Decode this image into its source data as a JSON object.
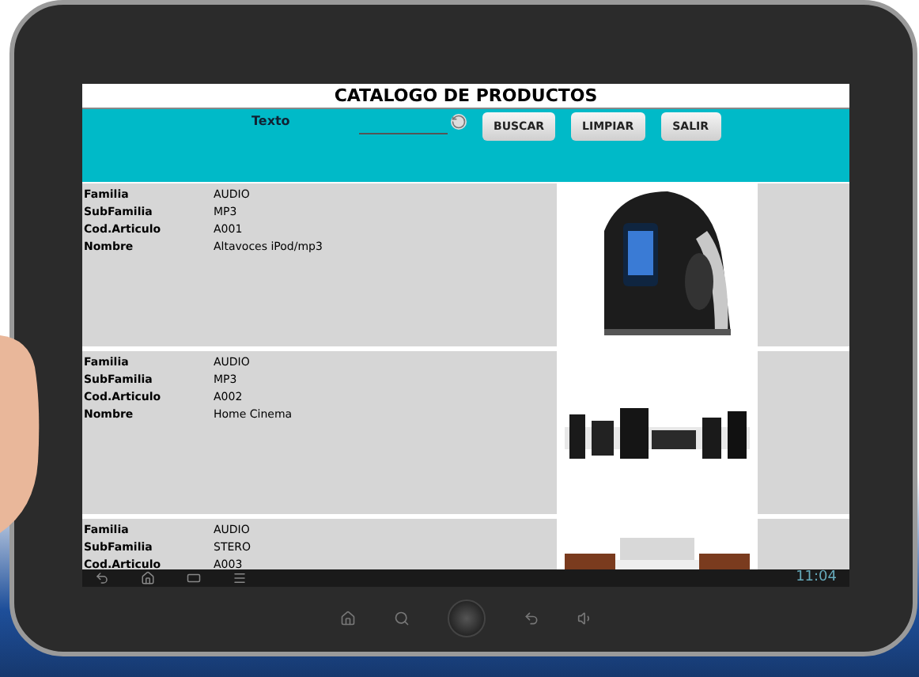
{
  "title": "CATALOGO DE PRODUCTOS",
  "search": {
    "label": "Texto"
  },
  "buttons": [
    "BUSCAR",
    "LIMPIAR",
    "SALIR"
  ],
  "products": [
    {
      "fields": [
        {
          "label": "Familia",
          "value": "AUDIO"
        },
        {
          "label": "SubFamilia",
          "value": "MP3"
        },
        {
          "label": "Cod.Articulo",
          "value": "A001"
        },
        {
          "label": "Nombre",
          "value": "Altavoces iPod/mp3"
        }
      ],
      "picture": {
        "kind": "picture"
      }
    },
    {
      "fields": [
        {
          "label": "Familia",
          "value": "AUDIO"
        },
        {
          "label": "SubFamilia",
          "value": "MP3"
        },
        {
          "label": "Cod.Articulo",
          "value": "A002"
        },
        {
          "label": "Nombre",
          "value": "Home Cinema"
        }
      ],
      "picture": {
        "kind": "picture"
      }
    },
    {
      "fields": [
        {
          "label": "Familia",
          "value": "AUDIO"
        },
        {
          "label": "SubFamilia",
          "value": "STERO"
        },
        {
          "label": "Cod.Articulo",
          "value": "A003"
        }
      ],
      "picture": {
        "kind": "picture"
      }
    }
  ],
  "status_bar": {
    "time": "11:04"
  }
}
